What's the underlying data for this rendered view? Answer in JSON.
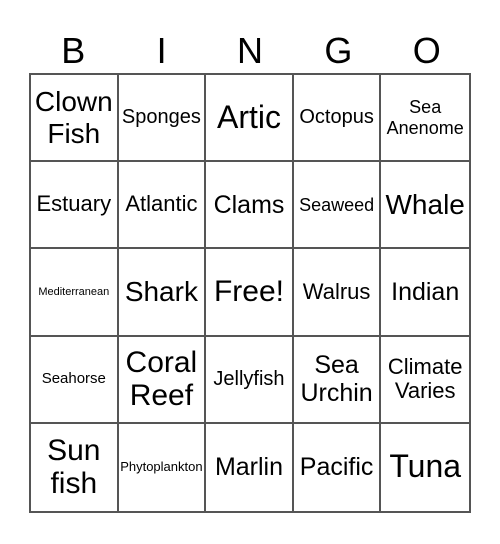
{
  "header": {
    "letters": [
      "B",
      "I",
      "N",
      "G",
      "O"
    ]
  },
  "card": {
    "rows": [
      [
        "Clown\nFish",
        "Sponges",
        "Artic",
        "Octopus",
        "Sea\nAnenome"
      ],
      [
        "Estuary",
        "Atlantic",
        "Clams",
        "Seaweed",
        "Whale"
      ],
      [
        "Mediterranean",
        "Shark",
        "Free!",
        "Walrus",
        "Indian"
      ],
      [
        "Seahorse",
        "Coral\nReef",
        "Jellyfish",
        "Sea\nUrchin",
        "Climate\nVaries"
      ],
      [
        "Sun\nfish",
        "Phytoplankton",
        "Marlin",
        "Pacific",
        "Tuna"
      ]
    ],
    "free_space": "Free!"
  }
}
